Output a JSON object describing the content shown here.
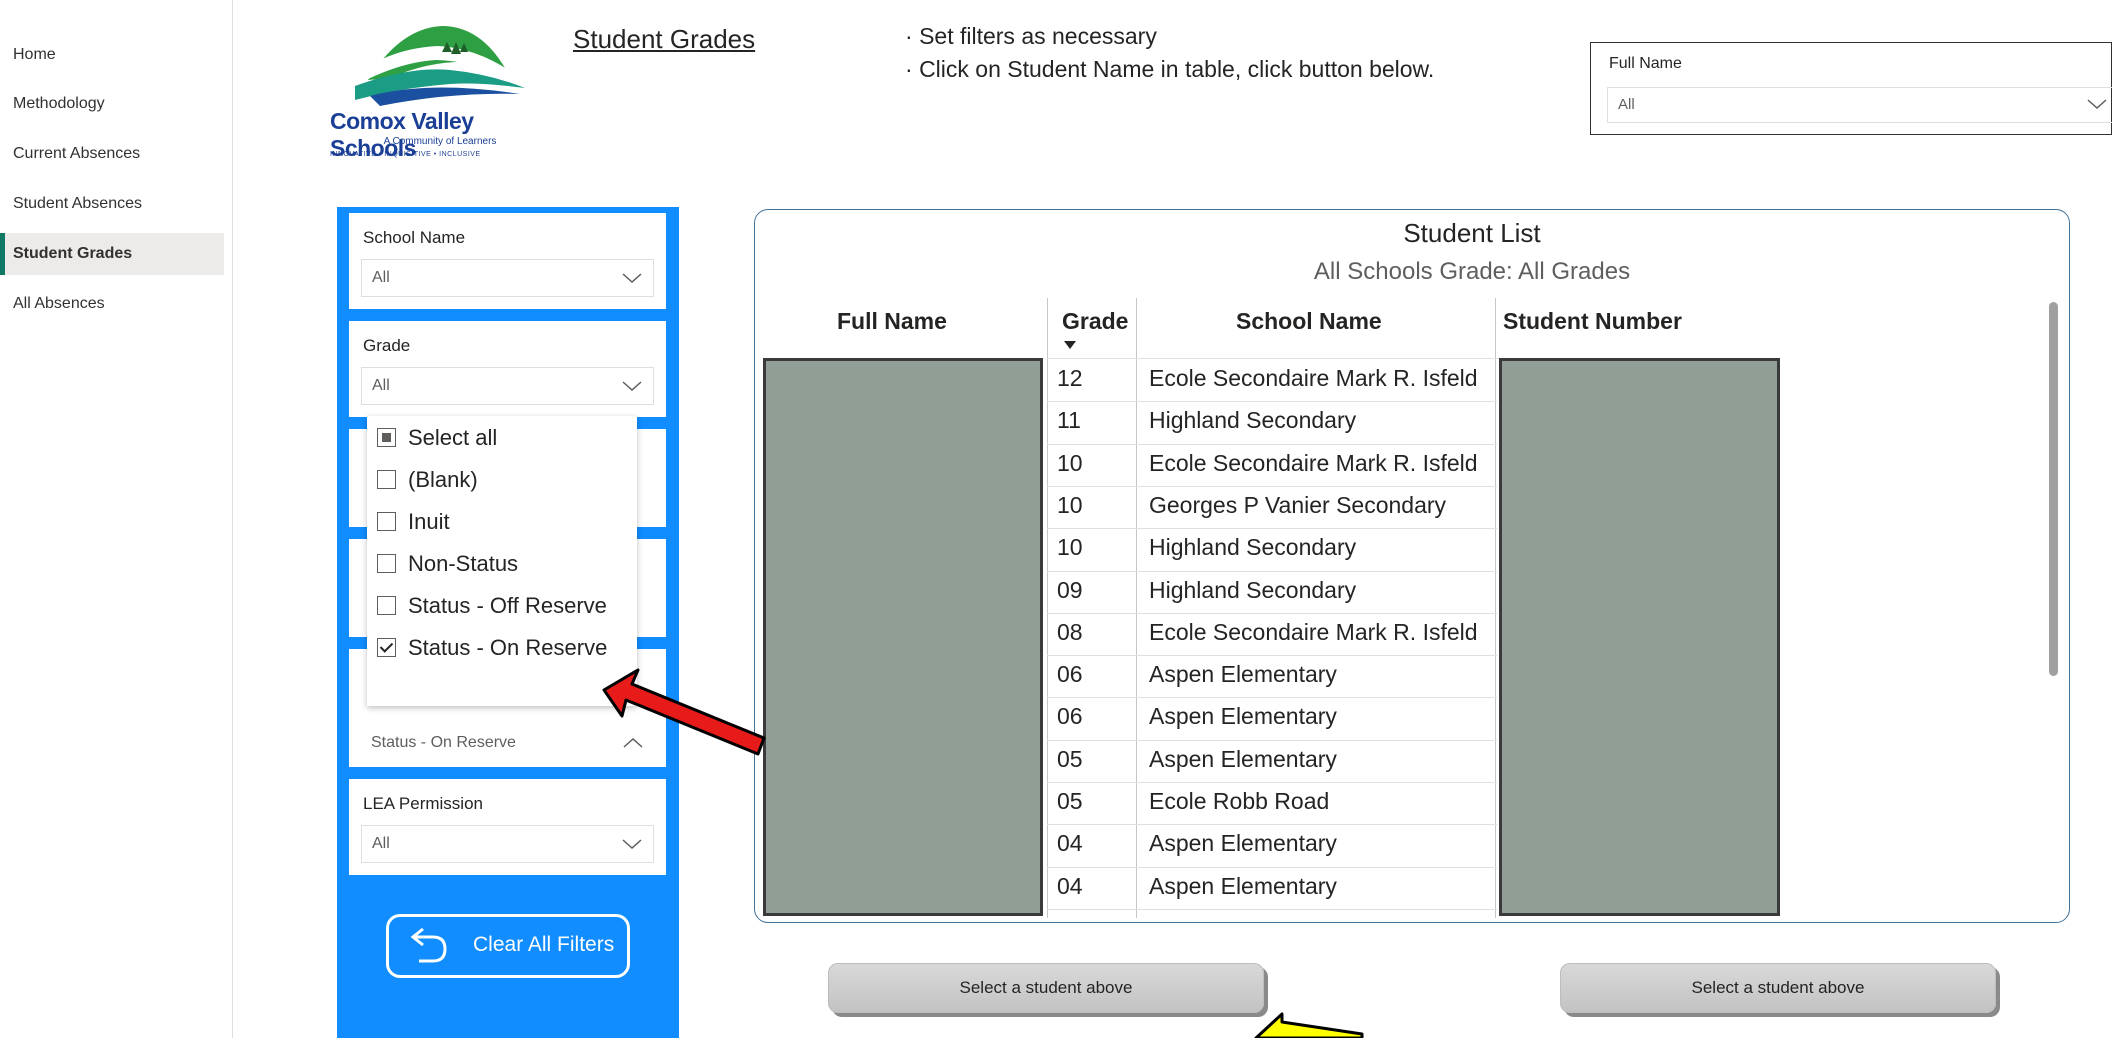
{
  "nav": {
    "items": [
      {
        "label": "Home",
        "active": false
      },
      {
        "label": "Methodology",
        "active": false
      },
      {
        "label": "Current Absences",
        "active": false
      },
      {
        "label": "Student Absences",
        "active": false
      },
      {
        "label": "Student Grades",
        "active": true
      },
      {
        "label": "All Absences",
        "active": false
      }
    ]
  },
  "logo": {
    "name": "Comox Valley Schools",
    "tagline": "A Community of Learners",
    "subline": "INNOVATIVE • INQUISITIVE • INCLUSIVE"
  },
  "page_title": "Student Grades",
  "instructions": [
    "Set filters as necessary",
    "Click on Student Name in table, click button below."
  ],
  "top_slicer": {
    "title": "Full Name",
    "value": "All"
  },
  "filters": {
    "school_name": {
      "title": "School Name",
      "value": "All"
    },
    "grade": {
      "title": "Grade",
      "value": "All"
    },
    "indigenous_status": {
      "value": "Status - On Reserve"
    },
    "lea_permission": {
      "title": "LEA Permission",
      "value": "All"
    },
    "grade_dropdown_options": [
      {
        "label": "Select all",
        "state": "partial"
      },
      {
        "label": "(Blank)",
        "state": "unchecked"
      },
      {
        "label": "Inuit",
        "state": "unchecked"
      },
      {
        "label": "Non-Status",
        "state": "unchecked"
      },
      {
        "label": "Status - Off Reserve",
        "state": "unchecked"
      },
      {
        "label": "Status - On Reserve",
        "state": "checked"
      }
    ],
    "clear_button": "Clear All Filters"
  },
  "table": {
    "title": "Student List",
    "subtitle": "All Schools  Grade:  All Grades",
    "columns": [
      "Full Name",
      "Grade",
      "School Name",
      "Student Number"
    ],
    "sort_column": "Grade",
    "rows": [
      {
        "grade": "12",
        "school": "Ecole Secondaire Mark R. Isfeld"
      },
      {
        "grade": "11",
        "school": "Highland Secondary"
      },
      {
        "grade": "10",
        "school": "Ecole Secondaire Mark R. Isfeld"
      },
      {
        "grade": "10",
        "school": "Georges P Vanier Secondary"
      },
      {
        "grade": "10",
        "school": "Highland Secondary"
      },
      {
        "grade": "09",
        "school": "Highland Secondary"
      },
      {
        "grade": "08",
        "school": "Ecole Secondaire Mark R. Isfeld"
      },
      {
        "grade": "06",
        "school": "Aspen Elementary"
      },
      {
        "grade": "06",
        "school": "Aspen Elementary"
      },
      {
        "grade": "05",
        "school": "Aspen Elementary"
      },
      {
        "grade": "05",
        "school": "Ecole Robb Road"
      },
      {
        "grade": "04",
        "school": "Aspen Elementary"
      },
      {
        "grade": "04",
        "school": "Aspen Elementary"
      }
    ]
  },
  "buttons": {
    "left": "Select a student above",
    "right": "Select a student above"
  },
  "colors": {
    "panel_blue": "#118dff",
    "nav_accent": "#117865",
    "arrow_red": "#e81b1b",
    "arrow_yellow": "#ffff00",
    "redaction": "#919e96"
  }
}
